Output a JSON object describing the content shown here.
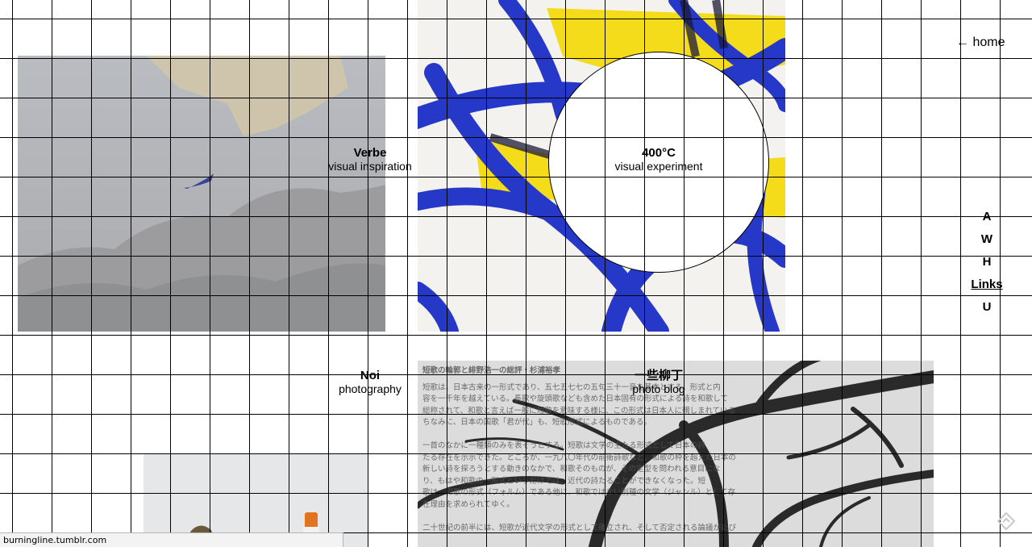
{
  "header": {
    "home_link": "← home"
  },
  "side_nav": {
    "items": [
      {
        "label": "A"
      },
      {
        "label": "W"
      },
      {
        "label": "H"
      },
      {
        "label": "Links",
        "active": true
      },
      {
        "label": "U"
      }
    ]
  },
  "tiles": [
    {
      "title": "Verbe",
      "subtitle": "visual inspiration"
    },
    {
      "title": "400°C",
      "subtitle": "visual experiment"
    },
    {
      "title": "Noi",
      "subtitle": "photography"
    },
    {
      "title": "一些柳丁",
      "subtitle": "photo blog"
    }
  ],
  "scan_text": {
    "heading": "短歌の輪郭と緋野浩一の総評・杉浦裕孝",
    "lines": [
      "短歌は、日本古来の一形式であり、五七五七七の五句三十一音を基本とする。形式と内",
      "容を一千年を越えている。長歌や旋頭歌なども含めた日本固有の形式による詩を和歌して",
      "総称されて、和歌と言えば一般に短歌を意味する様に、この形式は日本人に親しまれている",
      "ちなみに、日本の国歌「君が代」も、短歌形式によるものである。",
      "",
      "一首のなかに一種類のみを表そうとする。短歌は文学の主たる形式として日本の詩",
      "たる存在を示示できた。ところが、一九八〇年代の前衛詩歌など、和歌の枠を超えた日本の",
      "新しい詩を探ろうとする動きのなかで、和歌そのものが、その定型を問われる意目にな",
      "り、もはや和歌の一形式というだけでは、近代の詩たることができなくなった。短",
      "歌は、和歌の形式（フォルム）である他に、和歌ではない別種の文学（ジャンル）として存",
      "在理由を求められてゆく。",
      "",
      "二十世紀の前半には、短歌が近代文学の形式として確立され、そして否定される論議がたび"
    ]
  },
  "status_bar": {
    "url": "burningline.tumblr.com"
  },
  "icons": {
    "corner": "tumblr-controls-icon"
  }
}
